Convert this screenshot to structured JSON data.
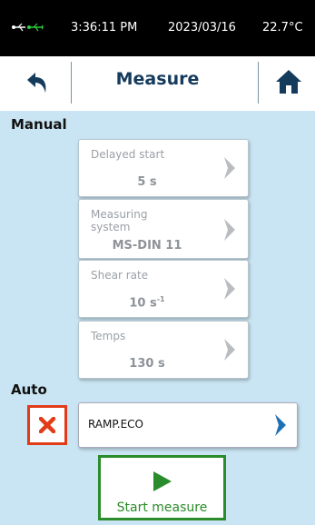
{
  "status_bar": {
    "icon": "usb-connection-icon",
    "time": "3:36:11 PM",
    "date": "2023/03/16",
    "temperature": "22.7°C"
  },
  "header": {
    "back_icon": "back-arrow-icon",
    "title": "Measure",
    "home_icon": "home-icon"
  },
  "manual": {
    "label": "Manual",
    "cards": [
      {
        "label": "Delayed start",
        "value": "5 s"
      },
      {
        "label": "Measuring\nsystem",
        "value": "MS-DIN 11"
      },
      {
        "label": "Shear rate",
        "value": "10 s",
        "unit_sup": "-1"
      },
      {
        "label": "Temps",
        "value": "130 s"
      }
    ]
  },
  "auto": {
    "label": "Auto",
    "program": "RAMP.ECO",
    "delete_icon": "close-x-icon",
    "chevron_icon": "chevron-right-icon"
  },
  "start": {
    "label": "Start measure",
    "icon": "play-icon"
  },
  "colors": {
    "background": "#c9e4f2",
    "header_text": "#143a5c",
    "delete_red": "#e23b17",
    "start_green": "#2a8c2a",
    "chevron_blue": "#1f6fb5"
  }
}
